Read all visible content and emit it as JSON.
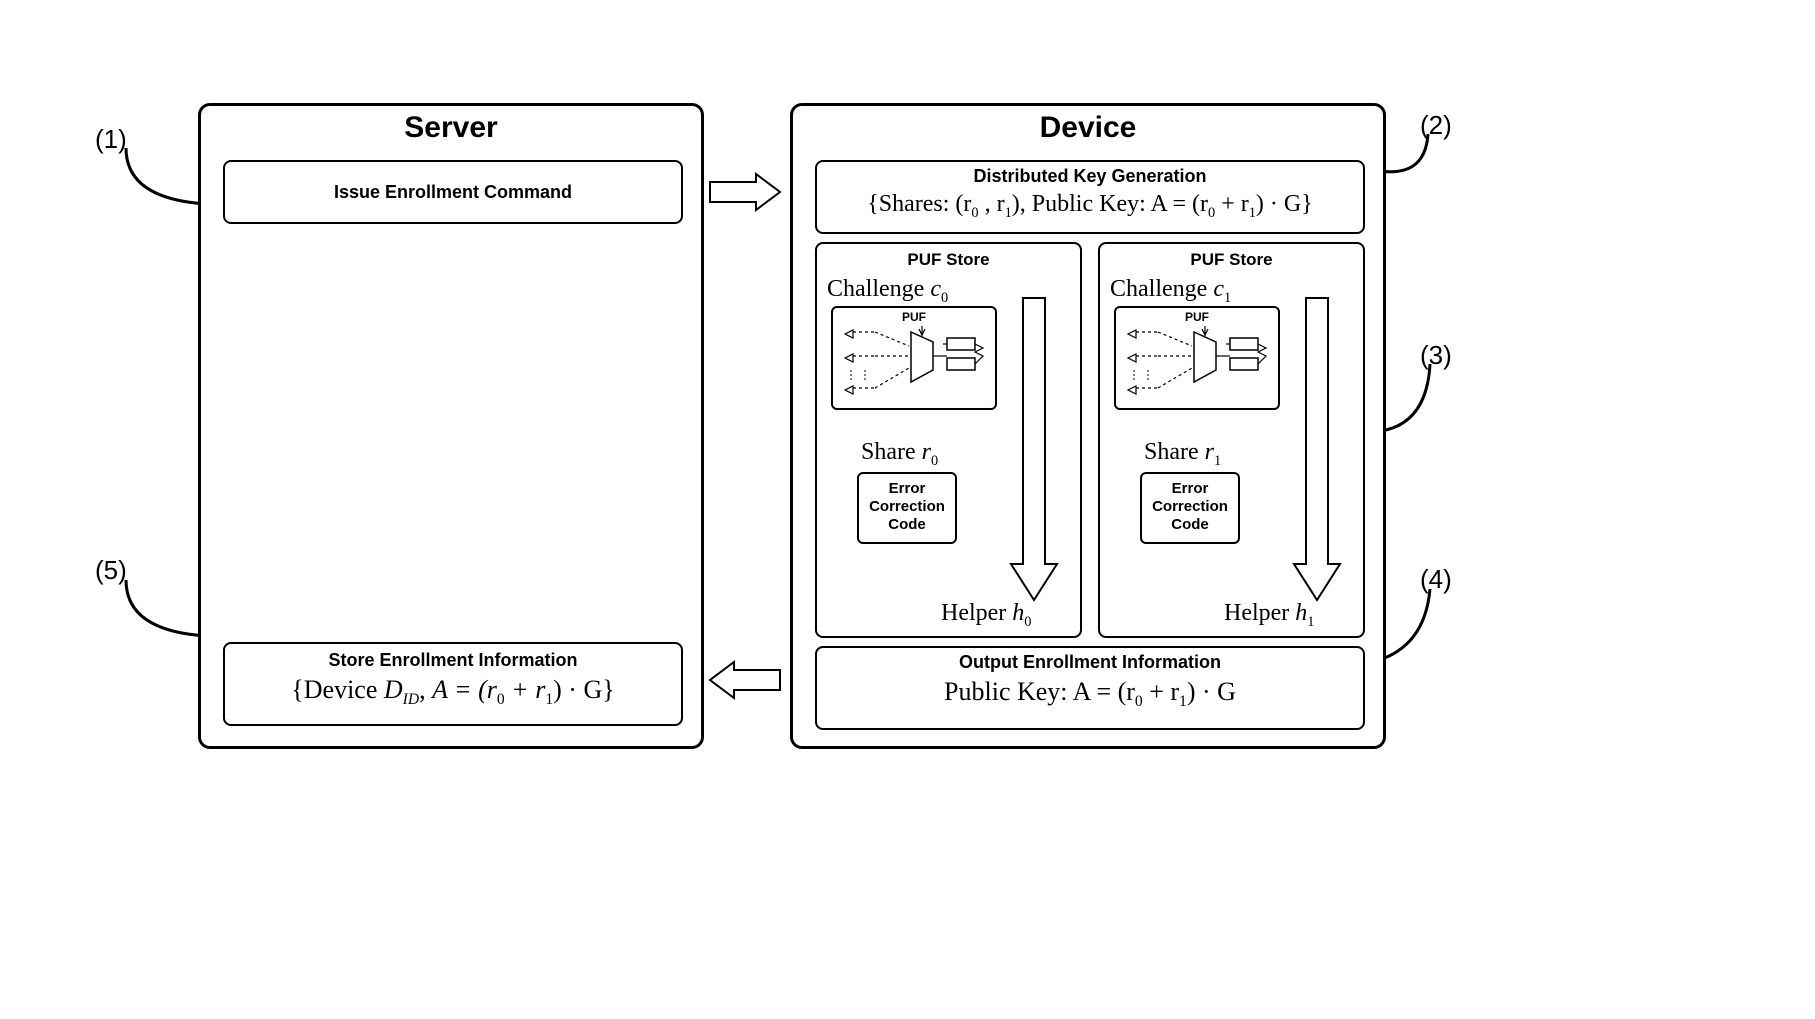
{
  "callouts": {
    "n1": "(1)",
    "n2": "(2)",
    "n3": "(3)",
    "n4": "(4)",
    "n5": "(5)"
  },
  "server": {
    "title": "Server",
    "issue_cmd": "Issue Enrollment Command",
    "store_title": "Store Enrollment Information",
    "store_formula_prefix": "{Device ",
    "store_D": "D",
    "store_ID": "ID",
    "store_mid": ", ",
    "store_A": "A = (r",
    "r0": "0",
    "plus": " + r",
    "r1": "1",
    "store_tail": ") · G}"
  },
  "device": {
    "title": "Device",
    "dkg_title": "Distributed Key Generation",
    "dkg_formula_prefix": "{Shares: (r",
    "r0": "0",
    "comma": " , r",
    "r1": "1",
    "dkg_mid": "), Public Key: A = (r",
    "dkg_plus": " + r",
    "dkg_tail": ") · G}",
    "puf_store_title": "PUF Store",
    "challenge": "Challenge ",
    "c": "c",
    "c0": "0",
    "c1": "1",
    "puf_label": "PUF",
    "share": "Share ",
    "r": "r",
    "sr0": "0",
    "sr1": "1",
    "ecc_l1": "Error",
    "ecc_l2": "Correction",
    "ecc_l3": "Code",
    "helper": "Helper ",
    "h": "h",
    "h0": "0",
    "h1": "1",
    "output_title": "Output Enrollment Information",
    "output_prefix": "Public Key: A = (r",
    "out_r0": "0",
    "out_plus": " + r",
    "out_r1": "1",
    "out_tail": ") · G"
  }
}
